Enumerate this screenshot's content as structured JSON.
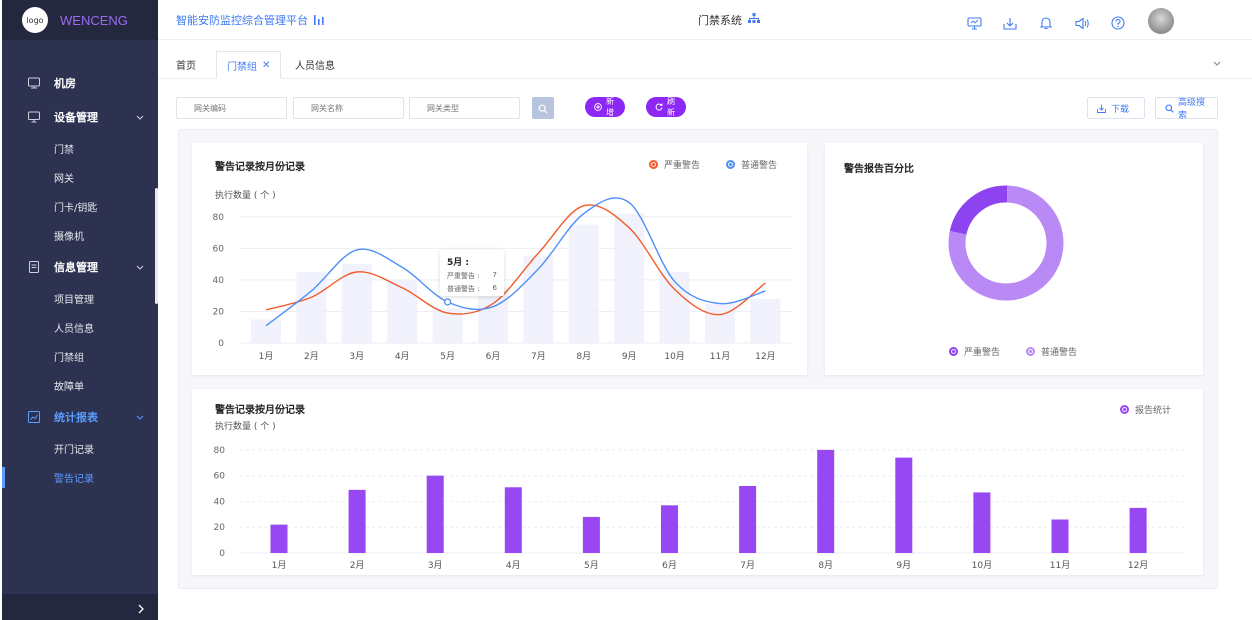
{
  "sidebar": {
    "logo": "logo",
    "brand": "WENCENG",
    "menu": [
      {
        "label": "机房",
        "icon": "server-room-icon",
        "type": "top",
        "active": false,
        "expandable": false
      },
      {
        "label": "设备管理",
        "icon": "monitor-icon",
        "type": "top",
        "active": false,
        "expandable": true
      },
      {
        "label": "门禁",
        "type": "sub",
        "active": false
      },
      {
        "label": "网关",
        "type": "sub",
        "active": false
      },
      {
        "label": "门卡/钥匙",
        "type": "sub",
        "active": false
      },
      {
        "label": "摄像机",
        "type": "sub",
        "active": false
      },
      {
        "label": "信息管理",
        "icon": "document-icon",
        "type": "top",
        "active": false,
        "expandable": true
      },
      {
        "label": "项目管理",
        "type": "sub",
        "active": false
      },
      {
        "label": "人员信息",
        "type": "sub",
        "active": false
      },
      {
        "label": "门禁组",
        "type": "sub",
        "active": false
      },
      {
        "label": "故障单",
        "type": "sub",
        "active": false
      },
      {
        "label": "统计报表",
        "icon": "chart-report-icon",
        "type": "top",
        "active": true,
        "expandable": true
      },
      {
        "label": "开门记录",
        "type": "sub",
        "active": false
      },
      {
        "label": "警告记录",
        "type": "sub",
        "active": true
      }
    ]
  },
  "header": {
    "platform_title": "智能安防监控综合管理平台",
    "center_title": "门禁系统",
    "icons": [
      "screen-icon",
      "download-icon",
      "bell-icon",
      "speaker-icon",
      "help-icon"
    ]
  },
  "tabs": [
    {
      "label": "首页",
      "active": false
    },
    {
      "label": "门禁组",
      "active": true,
      "closable": true
    },
    {
      "label": "人员信息",
      "active": false
    }
  ],
  "filters": {
    "gateway_code_placeholder": "网关编码",
    "gateway_name_placeholder": "网关名称",
    "gateway_type_placeholder": "网关类型",
    "add_label": "新增",
    "refresh_label": "刷新",
    "download_label": "下载",
    "advanced_search_label": "高级搜索"
  },
  "colors": {
    "accent_purple": "#8c27f4",
    "link_blue": "#3e7bf4",
    "severe_orange": "#f35b2c",
    "normal_blue": "#4f8ff7",
    "sidebar_bg": "#2d3250"
  },
  "line_card": {
    "title": "警告记录按月份记录",
    "unit": "执行数量 ( 个 )",
    "legend_severe": "严重警告",
    "legend_normal": "普通警告",
    "tooltip": {
      "title": "5月 :",
      "severe_label": "严重警告 :",
      "severe_value": "7",
      "normal_label": "普通警告 :",
      "normal_value": "6"
    }
  },
  "donut_card": {
    "title": "警告报告百分比",
    "legend_severe": "严重警告",
    "legend_normal": "普通警告"
  },
  "bar_card": {
    "title": "警告记录按月份记录",
    "unit": "执行数量 ( 个 )",
    "legend": "报告统计"
  },
  "chart_data": [
    {
      "type": "line",
      "title": "警告记录按月份记录",
      "ylabel": "执行数量 ( 个 )",
      "categories": [
        "1月",
        "2月",
        "3月",
        "4月",
        "5月",
        "6月",
        "7月",
        "8月",
        "9月",
        "10月",
        "11月",
        "12月"
      ],
      "ylim": [
        0,
        90
      ],
      "yticks": [
        0,
        20,
        40,
        60,
        80
      ],
      "grid": true,
      "legend_position": "top-right",
      "series": [
        {
          "name": "严重警告",
          "color": "#f35b2c",
          "values": [
            21,
            29,
            45,
            35,
            19,
            25,
            57,
            87,
            73,
            34,
            18,
            38
          ]
        },
        {
          "name": "普通警告",
          "color": "#4f8ff7",
          "values": [
            11,
            33,
            59,
            48,
            26,
            23,
            47,
            82,
            89,
            39,
            25,
            33
          ]
        }
      ],
      "background_bars": [
        15,
        45,
        50,
        40,
        22,
        35,
        55,
        75,
        82,
        45,
        25,
        28
      ]
    },
    {
      "type": "pie",
      "title": "警告报告百分比",
      "donut": true,
      "series": [
        {
          "name": "严重警告",
          "color": "#8d44f0",
          "value": 22
        },
        {
          "name": "普通警告",
          "color": "#b98af6",
          "value": 78
        }
      ],
      "legend_position": "bottom"
    },
    {
      "type": "bar",
      "title": "警告记录按月份记录",
      "ylabel": "执行数量 ( 个 )",
      "categories": [
        "1月",
        "2月",
        "3月",
        "4月",
        "5月",
        "6月",
        "7月",
        "8月",
        "9月",
        "10月",
        "11月",
        "12月"
      ],
      "ylim": [
        0,
        90
      ],
      "yticks": [
        0,
        20,
        40,
        60,
        80
      ],
      "grid": true,
      "legend_position": "top-right",
      "series": [
        {
          "name": "报告统计",
          "color": "#9748f2",
          "values": [
            22,
            49,
            60,
            51,
            28,
            37,
            52,
            80,
            74,
            47,
            26,
            35
          ]
        }
      ]
    }
  ]
}
